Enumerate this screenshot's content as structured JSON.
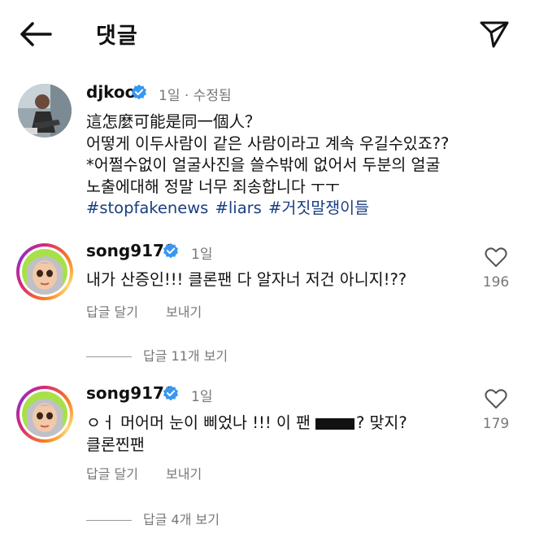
{
  "header": {
    "title": "댓글",
    "back_icon": "arrow-left-icon",
    "send_icon": "paper-plane-icon"
  },
  "post": {
    "username": "djkoo",
    "time": "1일",
    "edited": "· 수정됨",
    "lines": [
      "這怎麼可能是同一個人？",
      "어떻게 이두사람이 같은 사람이라고 계속 우길수있죠??",
      "*어쩔수없이 얼굴사진을 쓸수밖에 없어서 두분의 얼굴",
      "노출에대해 정말 너무 죄송합니다 ㅜㅜ"
    ],
    "hashtags": [
      "#stopfakenews",
      "#liars",
      "#거짓말쟁이들"
    ]
  },
  "comments": [
    {
      "username": "song9170",
      "time": "1일",
      "text": "내가 산증인!!! 클론팬 다 알자너 저건 아니지!??",
      "reply_label": "답글 달기",
      "send_label": "보내기",
      "likes": "196",
      "view_replies": "답글 11개 보기"
    },
    {
      "username": "song9170",
      "time": "1일",
      "text_part1": "ㅇㅓ 머어머 눈이 삐었나 !!! 이 팬",
      "text_part2": "? 맞지?",
      "text_line2": "클론찐팬",
      "reply_label": "답글 달기",
      "send_label": "보내기",
      "likes": "179",
      "view_replies": "답글 4개 보기"
    }
  ],
  "colors": {
    "verified": "#3897f0",
    "hashtag": "#1a3f82",
    "secondary": "#777777"
  }
}
